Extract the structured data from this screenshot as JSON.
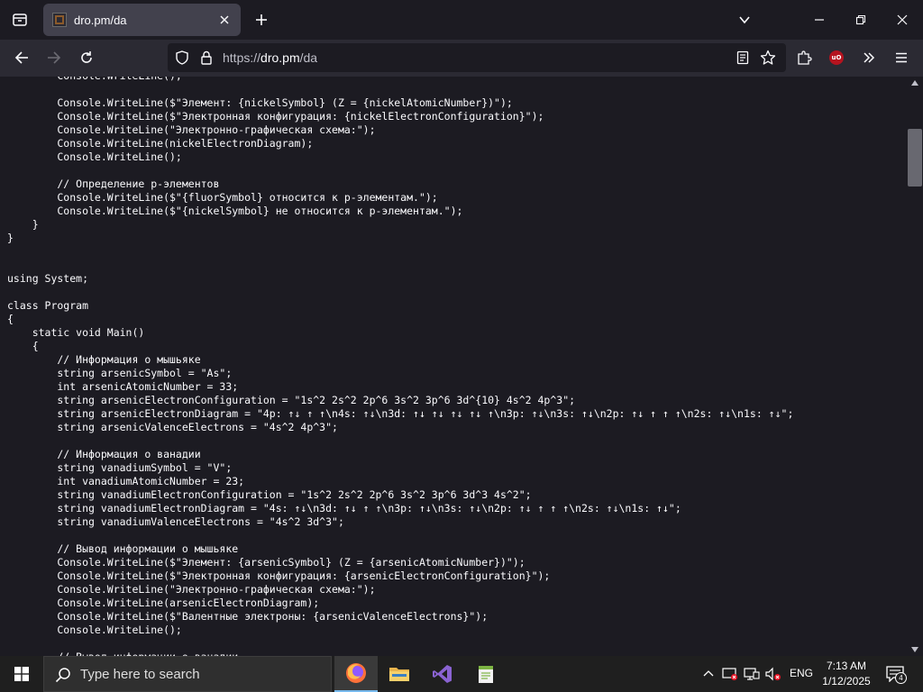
{
  "browser": {
    "tab": {
      "title": "dro.pm/da"
    },
    "url": {
      "scheme": "https://",
      "host": "dro.pm",
      "path": "/da"
    },
    "extensions": {
      "ublock_label": "uO"
    }
  },
  "page": {
    "code_lines": [
      "        Console.WriteLine();",
      "",
      "        Console.WriteLine($\"Элемент: {nickelSymbol} (Z = {nickelAtomicNumber})\");",
      "        Console.WriteLine($\"Электронная конфигурация: {nickelElectronConfiguration}\");",
      "        Console.WriteLine(\"Электронно-графическая схема:\");",
      "        Console.WriteLine(nickelElectronDiagram);",
      "        Console.WriteLine();",
      "",
      "        // Определение p-элементов",
      "        Console.WriteLine($\"{fluorSymbol} относится к p-элементам.\");",
      "        Console.WriteLine($\"{nickelSymbol} не относится к p-элементам.\");",
      "    }",
      "}",
      "",
      "",
      "using System;",
      "",
      "class Program",
      "{",
      "    static void Main()",
      "    {",
      "        // Информация о мышьяке",
      "        string arsenicSymbol = \"As\";",
      "        int arsenicAtomicNumber = 33;",
      "        string arsenicElectronConfiguration = \"1s^2 2s^2 2p^6 3s^2 3p^6 3d^{10} 4s^2 4p^3\";",
      "        string arsenicElectronDiagram = \"4p: ↑↓ ↑ ↑\\n4s: ↑↓\\n3d: ↑↓ ↑↓ ↑↓ ↑↓ ↑\\n3p: ↑↓\\n3s: ↑↓\\n2p: ↑↓ ↑ ↑ ↑\\n2s: ↑↓\\n1s: ↑↓\";",
      "        string arsenicValenceElectrons = \"4s^2 4p^3\";",
      "",
      "        // Информация о ванадии",
      "        string vanadiumSymbol = \"V\";",
      "        int vanadiumAtomicNumber = 23;",
      "        string vanadiumElectronConfiguration = \"1s^2 2s^2 2p^6 3s^2 3p^6 3d^3 4s^2\";",
      "        string vanadiumElectronDiagram = \"4s: ↑↓\\n3d: ↑↓ ↑ ↑\\n3p: ↑↓\\n3s: ↑↓\\n2p: ↑↓ ↑ ↑ ↑\\n2s: ↑↓\\n1s: ↑↓\";",
      "        string vanadiumValenceElectrons = \"4s^2 3d^3\";",
      "",
      "        // Вывод информации о мышьяке",
      "        Console.WriteLine($\"Элемент: {arsenicSymbol} (Z = {arsenicAtomicNumber})\");",
      "        Console.WriteLine($\"Электронная конфигурация: {arsenicElectronConfiguration}\");",
      "        Console.WriteLine(\"Электронно-графическая схема:\");",
      "        Console.WriteLine(arsenicElectronDiagram);",
      "        Console.WriteLine($\"Валентные электроны: {arsenicValenceElectrons}\");",
      "        Console.WriteLine();",
      "",
      "        // Вывод информации о ванадии"
    ]
  },
  "taskbar": {
    "search_placeholder": "Type here to search",
    "language": "ENG",
    "time": "7:13 AM",
    "date": "1/12/2025",
    "notification_count": "4"
  },
  "colors": {
    "chrome_bg": "#1c1b22",
    "toolbar_bg": "#2b2a33",
    "tab_active_bg": "#42414d",
    "page_text": "#fbfbfe",
    "taskbar_bg": "#1f1f1f",
    "ublock_red": "#b5131f"
  }
}
